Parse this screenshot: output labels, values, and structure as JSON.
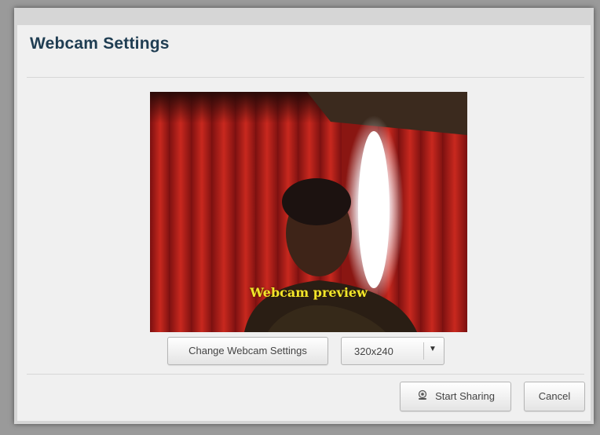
{
  "dialog": {
    "title": "Webcam Settings"
  },
  "preview": {
    "label": "Webcam preview"
  },
  "controls": {
    "change_settings_label": "Change Webcam Settings",
    "resolution": {
      "selected": "320x240"
    }
  },
  "footer": {
    "start_label": "Start Sharing",
    "start_icon": "webcam-icon",
    "cancel_label": "Cancel"
  },
  "colors": {
    "title": "#1f3d52",
    "preview_label": "#f2e52a",
    "dialog_bg": "#f0f0f0"
  }
}
